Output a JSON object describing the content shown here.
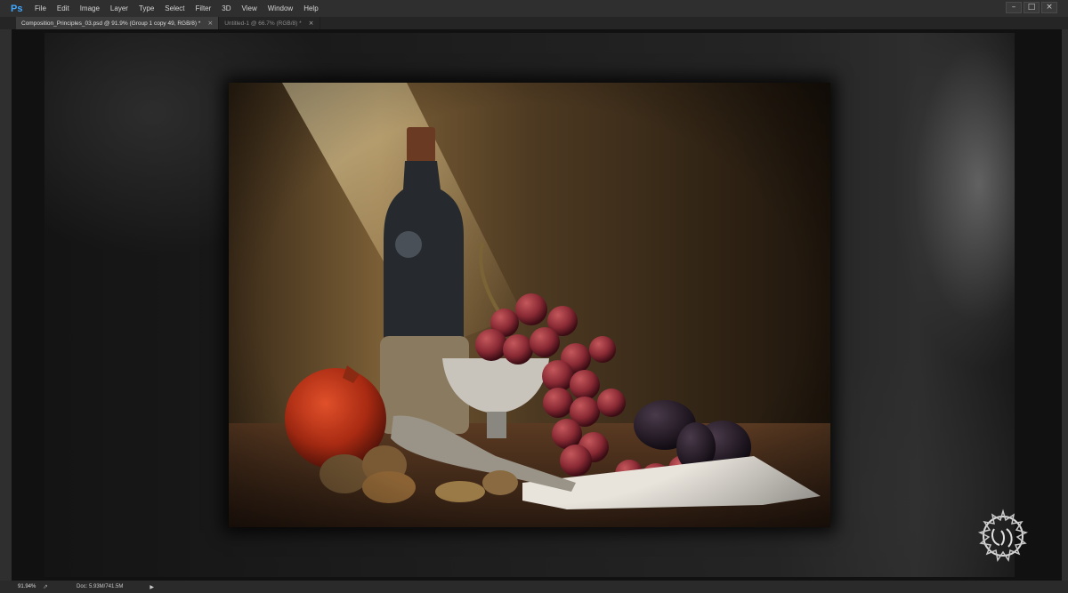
{
  "app": {
    "logo": "Ps",
    "menu": [
      "File",
      "Edit",
      "Image",
      "Layer",
      "Type",
      "Select",
      "Filter",
      "3D",
      "View",
      "Window",
      "Help"
    ],
    "window_controls": {
      "minimize": "–",
      "restore": "□",
      "close": "×"
    }
  },
  "tabs": [
    {
      "label": "Composition_Principles_03.psd @ 91.9% (Group 1 copy 49, RGB/8) *",
      "close": "×"
    },
    {
      "label": "Untitled-1 @ 66.7% (RGB/8) *",
      "close": "×"
    }
  ],
  "status": {
    "zoom": "91.94%",
    "export_icon": "⇗",
    "doc": "Doc: 5.93M/741.5M",
    "arrow": "▶"
  },
  "colors": {
    "ps_blue": "#3fa8ff",
    "app_bg": "#323232",
    "workarea": "#111111"
  },
  "icons": [
    "ps-logo",
    "minimize-icon",
    "restore-icon",
    "close-icon",
    "tab-close-icon",
    "export-icon",
    "status-arrow-icon",
    "watermark-logo"
  ]
}
